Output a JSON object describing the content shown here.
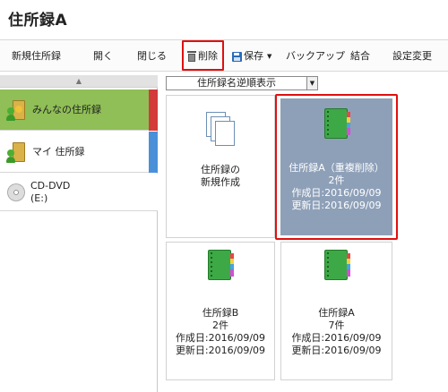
{
  "window": {
    "title": "住所録A"
  },
  "toolbar": {
    "new": "新規住所録",
    "open": "開く",
    "close": "閉じる",
    "delete": "削除",
    "save": "保存",
    "backup": "バックアップ",
    "merge": "結合",
    "settings": "設定変更"
  },
  "sidebar": {
    "items": [
      {
        "label": "みんなの住所録",
        "stripe": "#d33a3a"
      },
      {
        "label": "マイ 住所録",
        "stripe": "#4a90d9"
      },
      {
        "label_line1": "CD-DVD",
        "label_line2": "(E:)"
      }
    ]
  },
  "sort": {
    "selected": "住所録名逆順表示"
  },
  "tiles": {
    "new": {
      "line1": "住所録の",
      "line2": "新規作成"
    },
    "a_dup": {
      "name": "住所録A（重複削除）",
      "count": "2件",
      "created": "作成日:2016/09/09",
      "updated": "更新日:2016/09/09"
    },
    "b": {
      "name": "住所録B",
      "count": "2件",
      "created": "作成日:2016/09/09",
      "updated": "更新日:2016/09/09"
    },
    "a": {
      "name": "住所録A",
      "count": "7件",
      "created": "作成日:2016/09/09",
      "updated": "更新日:2016/09/09"
    }
  },
  "colors": {
    "selected_nav": "#8fbf56",
    "selected_tile": "#8ea0b8",
    "highlight": "#e01010"
  }
}
